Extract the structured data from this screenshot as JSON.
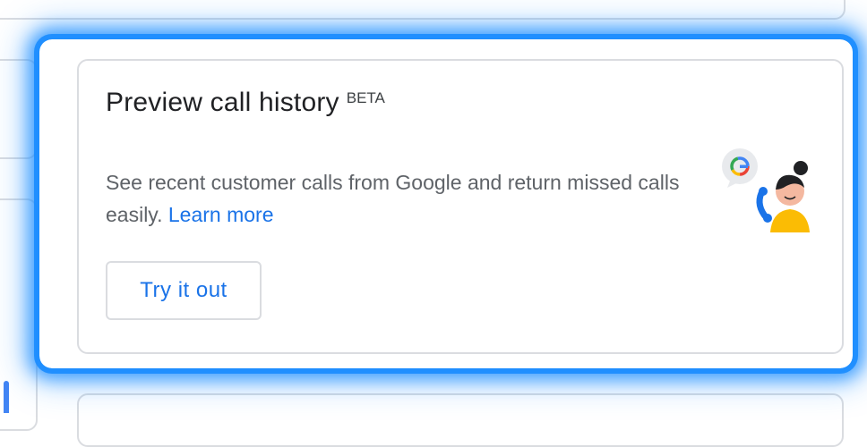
{
  "card": {
    "title": "Preview call history",
    "badge": "BETA",
    "description": "See recent customer calls from Google and return missed calls easily.",
    "learn_more": "Learn more",
    "try_button": "Try it out",
    "illustration_icon": "support-agent-phone-icon"
  },
  "colors": {
    "accent": "#1a73e8",
    "highlight": "#1a8cff",
    "border": "#dadce0"
  }
}
